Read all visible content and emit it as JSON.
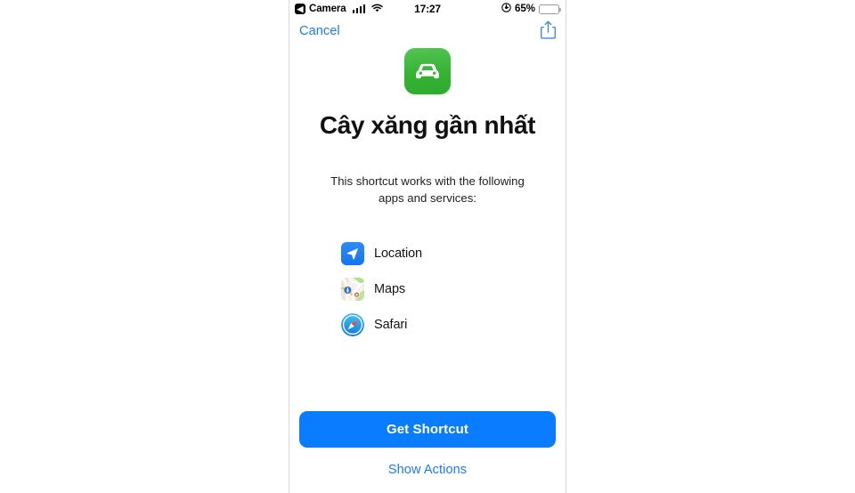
{
  "statusbar": {
    "back_label": "Camera",
    "back_chevron": "chevron-left-icon",
    "signal_icon": "cellular-signal-icon",
    "wifi_icon": "wifi-icon",
    "time": "17:27",
    "lowpower_icon": "low-power-mode-icon",
    "battery_percent": "65%",
    "battery_level": 65,
    "battery_color": "#ffcc00"
  },
  "navbar": {
    "cancel_label": "Cancel",
    "share_icon": "share-icon",
    "tint_color": "#1a7bff"
  },
  "header": {
    "app_icon": "car-icon",
    "app_icon_color": "#35b234",
    "title": "Cây xăng gần nhất",
    "subtitle": "This shortcut works with the following apps and services:"
  },
  "services": {
    "items": [
      {
        "label": "Location",
        "icon": "location-arrow-icon"
      },
      {
        "label": "Maps",
        "icon": "maps-icon"
      },
      {
        "label": "Safari",
        "icon": "safari-compass-icon"
      }
    ]
  },
  "actions": {
    "primary_label": "Get Shortcut",
    "primary_color": "#0a7cff",
    "secondary_label": "Show Actions"
  }
}
